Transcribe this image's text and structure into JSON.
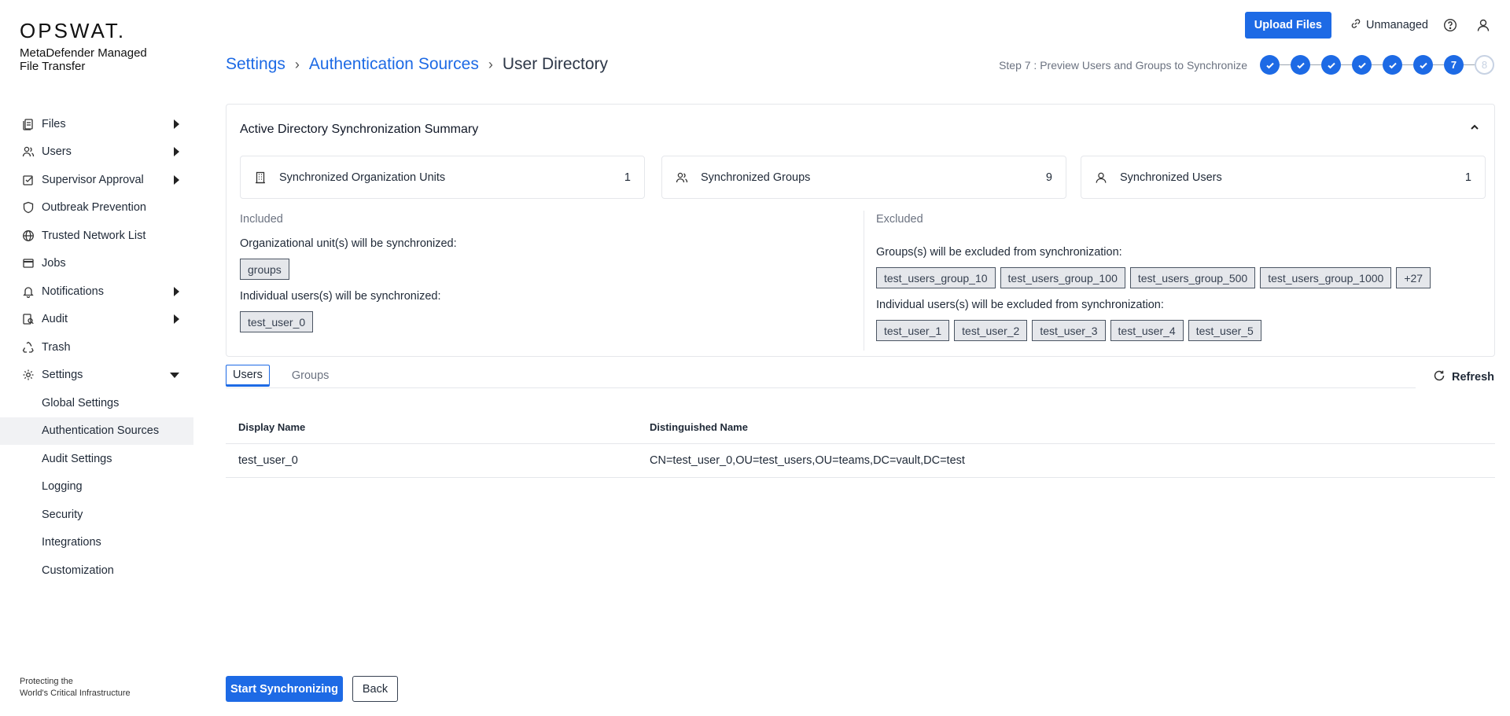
{
  "brand": {
    "logo": "OPSWAT.",
    "product": "MetaDefender Managed File Transfer",
    "tagline_line1": "Protecting the",
    "tagline_line2": "World's Critical Infrastructure"
  },
  "sidebar": {
    "items": [
      {
        "label": "Files",
        "icon": "files-icon",
        "expandable": true
      },
      {
        "label": "Users",
        "icon": "users-icon",
        "expandable": true
      },
      {
        "label": "Supervisor Approval",
        "icon": "approval-icon",
        "expandable": true
      },
      {
        "label": "Outbreak Prevention",
        "icon": "shield-icon",
        "expandable": false
      },
      {
        "label": "Trusted Network List",
        "icon": "globe-icon",
        "expandable": false
      },
      {
        "label": "Jobs",
        "icon": "jobs-icon",
        "expandable": false
      },
      {
        "label": "Notifications",
        "icon": "bell-icon",
        "expandable": true
      },
      {
        "label": "Audit",
        "icon": "audit-icon",
        "expandable": true
      },
      {
        "label": "Trash",
        "icon": "recycle-icon",
        "expandable": false
      },
      {
        "label": "Settings",
        "icon": "gear-icon",
        "expandable": true,
        "expanded": true
      }
    ],
    "settings_sub": [
      {
        "label": "Global Settings"
      },
      {
        "label": "Authentication Sources",
        "active": true
      },
      {
        "label": "Audit Settings"
      },
      {
        "label": "Logging"
      },
      {
        "label": "Security"
      },
      {
        "label": "Integrations"
      },
      {
        "label": "Customization"
      }
    ]
  },
  "header": {
    "upload_label": "Upload Files",
    "unmanaged_label": "Unmanaged"
  },
  "breadcrumb": {
    "part1": "Settings",
    "part2": "Authentication Sources",
    "current": "User Directory"
  },
  "stepper": {
    "label": "Step 7 : Preview Users and Groups to Synchronize",
    "current_step": "7",
    "last_step": "8",
    "total": 8,
    "completed": 6
  },
  "summary": {
    "title": "Active Directory Synchronization Summary",
    "stats": {
      "ou_label": "Synchronized Organization Units",
      "ou_value": "1",
      "groups_label": "Synchronized Groups",
      "groups_value": "9",
      "users_label": "Synchronized Users",
      "users_value": "1"
    },
    "included_title": "Included",
    "excluded_title": "Excluded",
    "included_ou_text": "Organizational unit(s) will be synchronized:",
    "included_ou_chips": [
      "groups"
    ],
    "included_users_text": "Individual users(s) will be synchronized:",
    "included_users_chips": [
      "test_user_0"
    ],
    "excluded_groups_text": "Groups(s) will be excluded from synchronization:",
    "excluded_groups_chips": [
      "test_users_group_10",
      "test_users_group_100",
      "test_users_group_500",
      "test_users_group_1000",
      "+27"
    ],
    "excluded_users_text": "Individual users(s) will be excluded from synchronization:",
    "excluded_users_chips": [
      "test_user_1",
      "test_user_2",
      "test_user_3",
      "test_user_4",
      "test_user_5"
    ]
  },
  "tabs": {
    "users": "Users",
    "groups": "Groups",
    "refresh": "Refresh"
  },
  "table": {
    "col1": "Display Name",
    "col2": "Distinguished Name",
    "rows": [
      {
        "display": "test_user_0",
        "dn": "CN=test_user_0,OU=test_users,OU=teams,DC=vault,DC=test"
      }
    ]
  },
  "footer": {
    "start_label": "Start Synchronizing",
    "back_label": "Back"
  },
  "colors": {
    "accent": "#1d6ae5"
  }
}
